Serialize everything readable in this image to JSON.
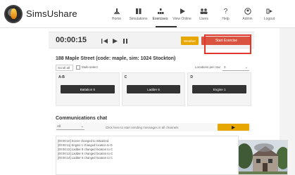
{
  "brand": "SimsUshare",
  "nav": [
    {
      "label": "Home",
      "icon": "home-icon"
    },
    {
      "label": "Simulations",
      "icon": "simulations-icon"
    },
    {
      "label": "Exercises",
      "icon": "exercises-icon"
    },
    {
      "label": "View Online",
      "icon": "play-icon"
    },
    {
      "label": "Users",
      "icon": "users-icon"
    },
    {
      "label": "Help",
      "icon": "help-icon"
    },
    {
      "label": "Admin",
      "icon": "user-icon"
    },
    {
      "label": "Logout",
      "icon": "logout-icon"
    }
  ],
  "active_nav": "Exercises",
  "control": {
    "timer": "00:00:15",
    "weather_label": "Weather",
    "start_label": "Start Exercise"
  },
  "scenario": {
    "title": "188 Maple Street (code: maple, sim: 1024 Stockton)",
    "select_value": "Scroll all",
    "multi_label": "Multi-select",
    "locations_label": "Locations per row:",
    "locations_value": "3"
  },
  "panels": [
    {
      "title": "A-B",
      "unit": "Battalion 5"
    },
    {
      "title": "C",
      "unit": "Ladder 6"
    },
    {
      "title": "D",
      "unit": "Engine 1"
    }
  ],
  "chat": {
    "title": "Communications chat",
    "channel": "All",
    "placeholder": "Click here to start sending messages in all channels",
    "log": [
      "[00:00:10] Scene changed to Initialized",
      "[00:00:11] Engine 1 changed location to D",
      "[00:00:12] Ladder 6 changed location to C",
      "[00:00:13] Ladder 6 changed location to C",
      "[00:00:14] Ladder 6 changed location to C"
    ]
  },
  "colors": {
    "accent_yellow": "#e8a600",
    "accent_red": "#d9533f",
    "highlight": "#e0362c",
    "dark_button": "#333333"
  }
}
